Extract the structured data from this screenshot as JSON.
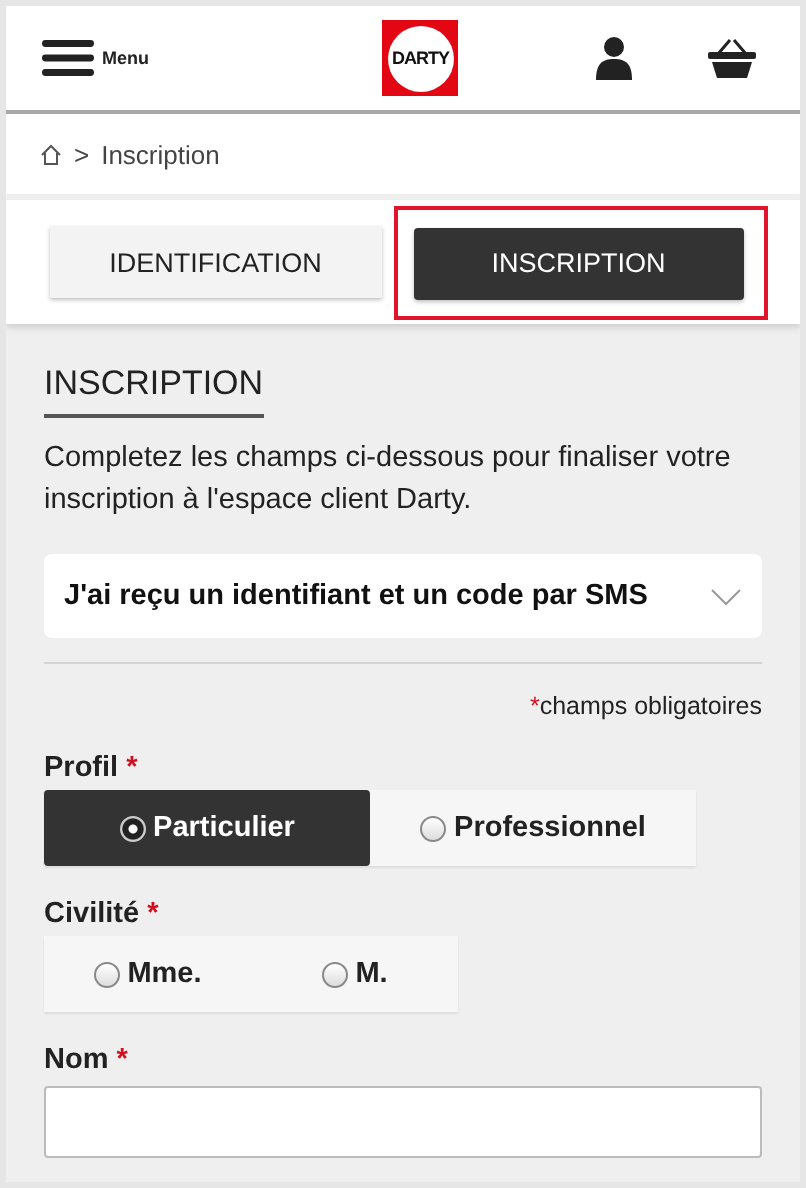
{
  "header": {
    "menu_label": "Menu",
    "logo_text": "DARTY"
  },
  "breadcrumb": {
    "separator": ">",
    "current": "Inscription"
  },
  "tabs": [
    {
      "label": "IDENTIFICATION",
      "selected": false,
      "highlighted": false
    },
    {
      "label": "INSCRIPTION",
      "selected": true,
      "highlighted": true
    }
  ],
  "section_title": "INSCRIPTION",
  "intro": "Completez les champs ci-dessous pour finaliser votre inscription à l'espace client Darty.",
  "dropdown": {
    "value": "J'ai reçu un identifiant et un code par SMS",
    "expanded": false
  },
  "required_note": {
    "mark": "*",
    "text": "champs obligatoires"
  },
  "groups": [
    {
      "label": "Profil",
      "mark": "*",
      "kind": "segmented",
      "options": [
        {
          "label": "Particulier",
          "selected": true
        },
        {
          "label": "Professionnel",
          "selected": false
        }
      ]
    },
    {
      "label": "Civilité",
      "mark": "*",
      "kind": "plain",
      "options": [
        {
          "label": "Mme.",
          "selected": false
        },
        {
          "label": "M.",
          "selected": false
        }
      ]
    }
  ],
  "name_field": {
    "label": "Nom",
    "mark": "*"
  }
}
